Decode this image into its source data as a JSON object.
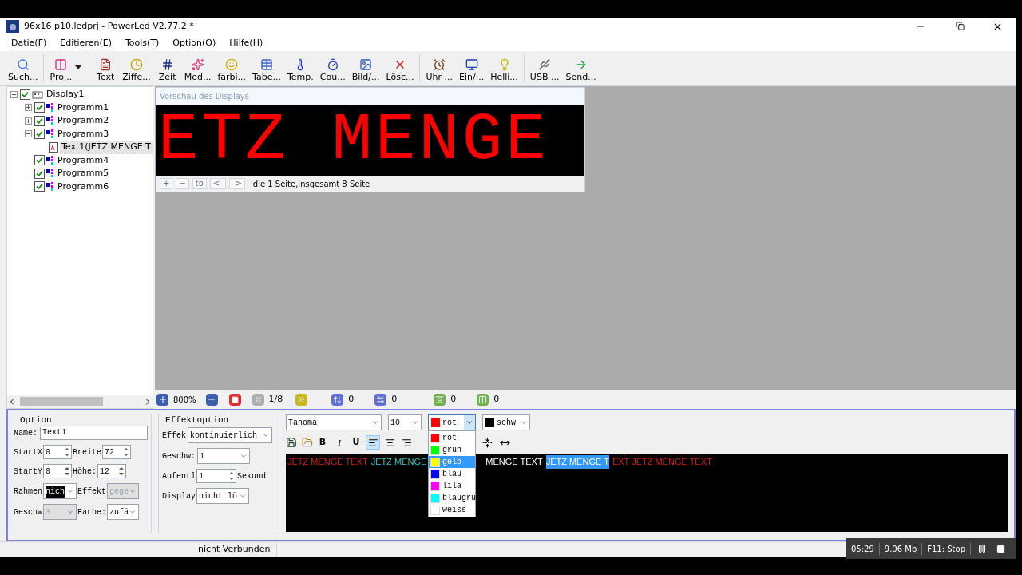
{
  "window": {
    "title": "96x16 p10.ledprj - PowerLed V2.77.2 *"
  },
  "menu": [
    "Datie(F)",
    "Editieren(E)",
    "Tools(T)",
    "Option(O)",
    "Hilfe(H)"
  ],
  "toolbar": [
    {
      "label": "Such...",
      "kind": "search"
    },
    {
      "label": "Pro...",
      "kind": "program",
      "dropdown": true
    },
    {
      "label": "Text",
      "kind": "text"
    },
    {
      "label": "Ziffe...",
      "kind": "clock"
    },
    {
      "label": "Zeit",
      "kind": "time"
    },
    {
      "label": "Med...",
      "kind": "media"
    },
    {
      "label": "farbi...",
      "kind": "smile"
    },
    {
      "label": "Tabe...",
      "kind": "table"
    },
    {
      "label": "Temp.",
      "kind": "temp"
    },
    {
      "label": "Cou...",
      "kind": "count"
    },
    {
      "label": "Bild/...",
      "kind": "image"
    },
    {
      "label": "Lösc...",
      "kind": "delete"
    },
    {
      "label": "Uhr ...",
      "kind": "alarm"
    },
    {
      "label": "Ein/...",
      "kind": "monitor"
    },
    {
      "label": "Helli...",
      "kind": "bulb"
    },
    {
      "label": "USB ...",
      "kind": "usb"
    },
    {
      "label": "Send...",
      "kind": "send"
    }
  ],
  "tree": [
    {
      "label": "Display1",
      "kind": "display",
      "checked": true,
      "expanded": true,
      "children": [
        {
          "label": "Programm1",
          "kind": "program",
          "checked": true,
          "expanded": false
        },
        {
          "label": "Programm2",
          "kind": "program",
          "checked": true,
          "expanded": false
        },
        {
          "label": "Programm3",
          "kind": "program",
          "checked": true,
          "expanded": true,
          "children": [
            {
              "label": "Text1(JETZ MENGE T",
              "kind": "text",
              "selected": true
            }
          ]
        },
        {
          "label": "Programm4",
          "kind": "program",
          "checked": true
        },
        {
          "label": "Programm5",
          "kind": "program",
          "checked": true
        },
        {
          "label": "Programm6",
          "kind": "program",
          "checked": true
        }
      ]
    }
  ],
  "preview": {
    "title": "Vorschau des Displays",
    "led_text": "ETZ MENGE",
    "nav": [
      "+",
      "−",
      "to",
      "<-",
      "->"
    ],
    "page_info": "die 1 Seite,insgesamt 8 Seite"
  },
  "canvas_bar": {
    "zoom": "800%",
    "page": "1/8",
    "values": [
      "0",
      "0",
      "0",
      "0"
    ]
  },
  "option": {
    "title": "Option",
    "name_label": "Name:",
    "name": "Text1",
    "startx_label": "StartX",
    "startx": "0",
    "breite_label": "Breite",
    "breite": "72",
    "starty_label": "StartY",
    "starty": "0",
    "hoehe_label": "Höhe:",
    "hoehe": "12",
    "rahmen_label": "Rahmen",
    "rahmen": "nich",
    "effekt_label": "Effekt",
    "effekt": "gege",
    "geschw_label": "Geschw",
    "geschw": "3",
    "farbe_label": "Farbe:",
    "farbe": "zufä"
  },
  "effekt": {
    "title": "Effektoption",
    "effek_label": "Effek",
    "effek": "kontinuierlich",
    "geschw_label": "Geschw:",
    "geschw": "1",
    "aufent_label": "Aufentl",
    "aufent": "1",
    "sekund": "Sekund",
    "display_label": "Display",
    "display": "nicht lö"
  },
  "editor": {
    "font": "Tahoma",
    "size": "10",
    "color": {
      "label": "rot",
      "color": "#ff0000"
    },
    "background": {
      "label": "schw",
      "color": "#000000"
    },
    "color_options": [
      {
        "label": "rot",
        "color": "#ff0000",
        "selected": false
      },
      {
        "label": "grün",
        "color": "#00ff00",
        "selected": false
      },
      {
        "label": "gelb",
        "color": "#ffff00",
        "selected": true
      },
      {
        "label": "blau",
        "color": "#0000ff",
        "selected": false
      },
      {
        "label": "lila",
        "color": "#ff00ff",
        "selected": false
      },
      {
        "label": "blaugrü",
        "color": "#00ffff",
        "selected": false
      },
      {
        "label": "weiss",
        "color": "#ffffff",
        "selected": false
      }
    ],
    "format_buttons": [
      {
        "label": "B",
        "kind": "bold",
        "selected": false
      },
      {
        "label": "I",
        "kind": "italic",
        "selected": false
      },
      {
        "label": "U",
        "kind": "underline",
        "selected": false
      }
    ],
    "alignment": [
      {
        "kind": "left",
        "selected": true
      },
      {
        "kind": "center",
        "selected": false
      },
      {
        "kind": "right",
        "selected": false
      }
    ],
    "segments": [
      {
        "text": "JETZ MENGE TEXT",
        "color": "#d02020",
        "selected": false
      },
      {
        "text": "JETZ MENGE",
        "color": "#40c0c0",
        "selected": false
      },
      {
        "text": "MENGE TEXT",
        "color": "#ffffff",
        "selected": false
      },
      {
        "text": "JETZ MENGE T",
        "selected": true
      },
      {
        "text": "EXT JETZ MENGE TEXT",
        "color": "#d02020",
        "selected": false
      }
    ]
  },
  "status_bar": {
    "connection": "nicht Verbunden"
  },
  "recorder": {
    "time": "05:29",
    "size": "9.06 Mb",
    "stop_hint": "F11: Stop"
  }
}
